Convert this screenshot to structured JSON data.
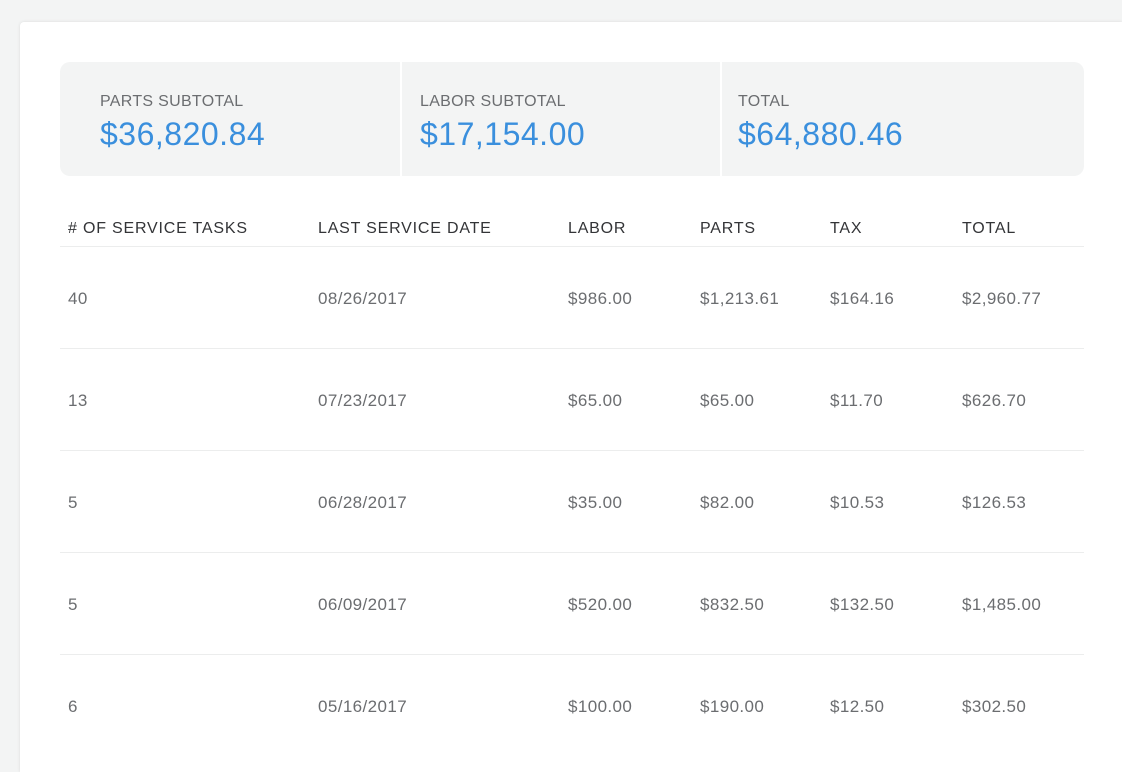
{
  "summary": {
    "parts_label": "PARTS SUBTOTAL",
    "parts_value": "$36,820.84",
    "labor_label": "LABOR SUBTOTAL",
    "labor_value": "$17,154.00",
    "total_label": "TOTAL",
    "total_value": "$64,880.46"
  },
  "table": {
    "headers": [
      "# OF SERVICE TASKS",
      "LAST SERVICE DATE",
      "LABOR",
      "PARTS",
      "TAX",
      "TOTAL"
    ],
    "rows": [
      [
        "40",
        "08/26/2017",
        "$986.00",
        "$1,213.61",
        "$164.16",
        "$2,960.77"
      ],
      [
        "13",
        "07/23/2017",
        "$65.00",
        "$65.00",
        "$11.70",
        "$626.70"
      ],
      [
        "5",
        "06/28/2017",
        "$35.00",
        "$82.00",
        "$10.53",
        "$126.53"
      ],
      [
        "5",
        "06/09/2017",
        "$520.00",
        "$832.50",
        "$132.50",
        "$1,485.00"
      ],
      [
        "6",
        "05/16/2017",
        "$100.00",
        "$190.00",
        "$12.50",
        "$302.50"
      ]
    ]
  },
  "colors": {
    "accent": "#3a8fdd",
    "muted_text": "#6b6d70",
    "header_text": "#333437",
    "panel_bg": "#f3f4f4"
  }
}
